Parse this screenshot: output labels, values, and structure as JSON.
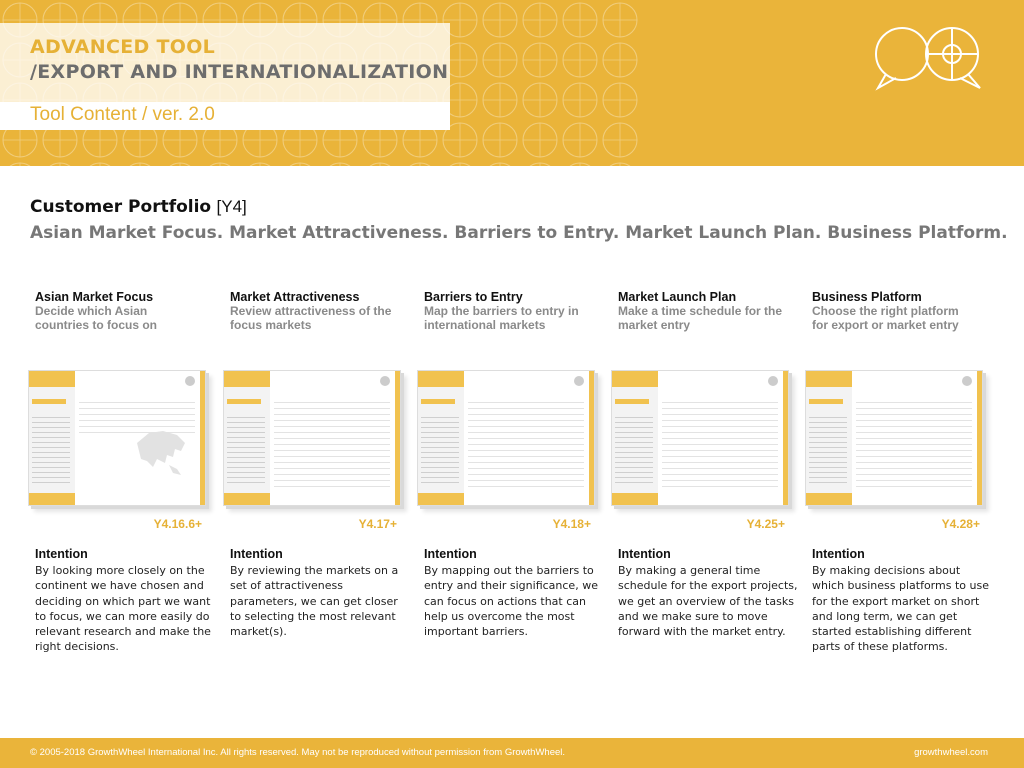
{
  "header": {
    "title_line1": "ADVANCED TOOL",
    "title_line2": "/EXPORT AND INTERNATIONALIZATION",
    "subtitle": "Tool Content / ver. 2.0",
    "logo_icon": "speech-bubbles-logo-icon"
  },
  "section": {
    "title": "Customer Portfolio",
    "code": "[Y4]",
    "subtitle": "Asian Market Focus. Market Attractiveness. Barriers to Entry. Market Launch Plan. Business Platform."
  },
  "tools": [
    {
      "name": "Asian Market Focus",
      "desc": "Decide which Asian countries to focus on",
      "code": "Y4.16.6+",
      "intention_label": "Intention",
      "intention": "By looking more closely on the continent we have chosen and deciding on which part we want to focus, we can more easily do relevant research and make the right decisions."
    },
    {
      "name": "Market Attractiveness",
      "desc": "Review attractiveness of the focus markets",
      "code": "Y4.17+",
      "intention_label": "Intention",
      "intention": "By reviewing the markets on a set of attractiveness parameters, we can get closer to selecting the most relevant market(s)."
    },
    {
      "name": "Barriers to Entry",
      "desc": "Map the barriers to entry in international markets",
      "code": "Y4.18+",
      "intention_label": "Intention",
      "intention": "By mapping out the barriers to entry and their significance, we can focus on actions that can help us overcome the most important barriers."
    },
    {
      "name": "Market Launch Plan",
      "desc": "Make a time schedule for the market entry",
      "code": "Y4.25+",
      "intention_label": "Intention",
      "intention": "By making a general time schedule for the export projects, we get an overview of the tasks and we make sure to move forward with the market entry."
    },
    {
      "name": "Business Platform",
      "desc": "Choose the right platform for export or market entry",
      "code": "Y4.28+",
      "intention_label": "Intention",
      "intention": "By making decisions about which business platforms to use for the export market on short and long term, we can get started establishing different parts of these platforms."
    }
  ],
  "footer": {
    "copyright": "© 2005-2018 GrowthWheel International Inc. All rights reserved. May not be reproduced without permission from GrowthWheel.",
    "site": "growthwheel.com"
  },
  "colors": {
    "accent": "#eab43a",
    "gray_text": "#777777"
  }
}
